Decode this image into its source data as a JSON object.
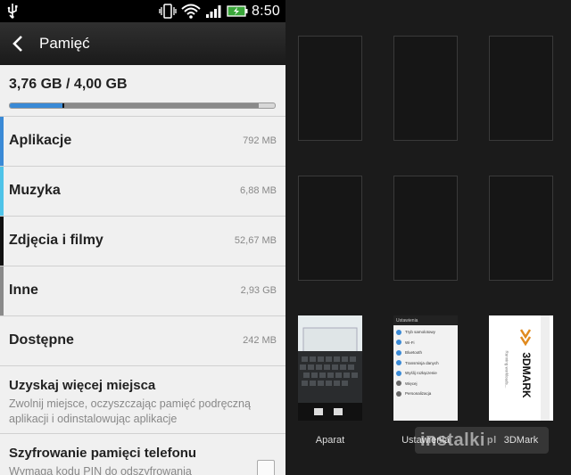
{
  "status_bar": {
    "time": "8:50",
    "icons": [
      "usb-icon",
      "vibrate-icon",
      "wifi-icon",
      "signal-icon",
      "battery-charging-icon"
    ]
  },
  "action_bar": {
    "title": "Pamięć",
    "back_icon": "back-chevron-icon"
  },
  "storage": {
    "total": "3,76 GB / 4,00 GB",
    "usage_fraction": 0.94,
    "categories": [
      {
        "label": "Aplikacje",
        "value": "792 MB",
        "color": "#3a8ad6"
      },
      {
        "label": "Muzyka",
        "value": "6,88 MB",
        "color": "#4fc3e8"
      },
      {
        "label": "Zdjęcia i filmy",
        "value": "52,67 MB",
        "color": "#111111"
      },
      {
        "label": "Inne",
        "value": "2,93 GB",
        "color": "#8a8a8a"
      },
      {
        "label": "Dostępne",
        "value": "242 MB",
        "color": ""
      }
    ]
  },
  "more_space": {
    "title": "Uzyskaj więcej miejsca",
    "summary": "Zwolnij miejsce, oczyszczając pamięć podręczną aplikacji i odinstalowując aplikacje"
  },
  "encryption": {
    "title": "Szyfrowanie pamięci telefonu",
    "summary": "Wymaga kodu PIN do odszyfrowania",
    "checked": false
  },
  "recent_apps": {
    "apps": [
      {
        "label": "Aparat",
        "icon": "camera-thumbnail"
      },
      {
        "label": "Ustawienia",
        "icon": "settings-thumbnail"
      },
      {
        "label": "3DMark",
        "icon": "3dmark-thumbnail"
      }
    ],
    "thumbnail_text": {
      "settings_header": "Ustawienia",
      "settings_items": [
        "Tryb samolotowy",
        "Wi-Fi",
        "Bluetooth",
        "Transmisja danych",
        "Wyślij rozłączenie",
        "Więcej",
        "Personalizacja"
      ],
      "brand": "3DMARK",
      "brand_sub": "Running workloads..."
    },
    "empty_slots": 6
  },
  "watermark": {
    "text": "instalki",
    "suffix": "pl"
  }
}
